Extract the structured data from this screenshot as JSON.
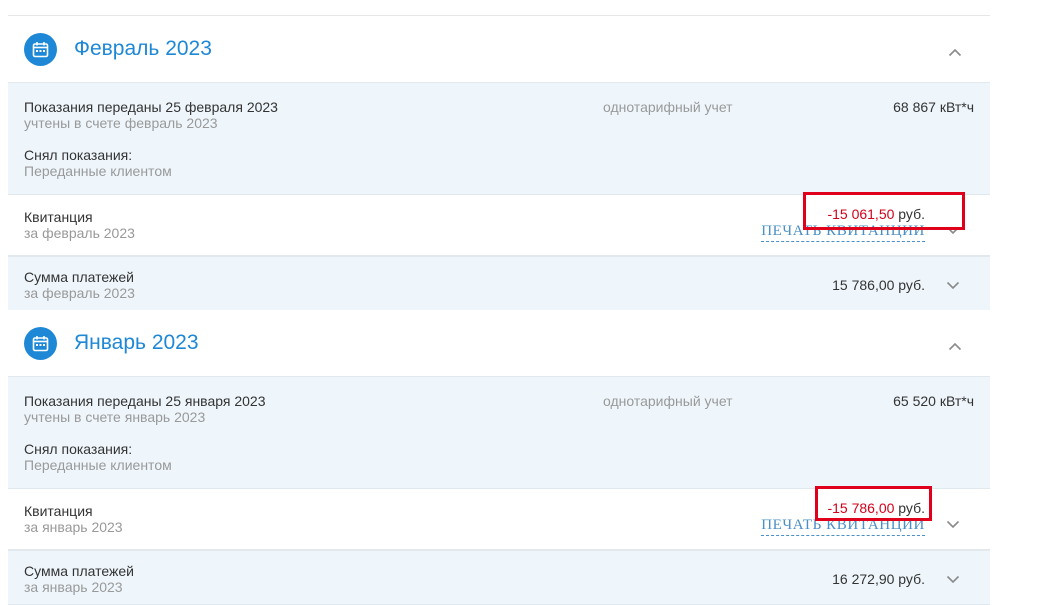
{
  "months": [
    {
      "title": "Февраль 2023",
      "readings": {
        "date_text": "Показания переданы 25 февраля 2023",
        "account_text": "учтены в счете февраль 2023",
        "tariff": "однотарифный учет",
        "value": "68 867 кВт*ч",
        "taken_by_label": "Снял показания:",
        "taken_by_value": "Переданные клиентом"
      },
      "receipt": {
        "label": "Квитанция",
        "period": "за февраль 2023",
        "amount": "-15 061,50",
        "currency": "руб.",
        "print_label": "ПЕЧАТЬ КВИТАНЦИИ"
      },
      "payments": {
        "label": "Сумма платежей",
        "period": "за февраль 2023",
        "amount": "15 786,00 руб."
      }
    },
    {
      "title": "Январь 2023",
      "readings": {
        "date_text": "Показания переданы 25 января 2023",
        "account_text": "учтены в счете январь 2023",
        "tariff": "однотарифный учет",
        "value": "65 520 кВт*ч",
        "taken_by_label": "Снял показания:",
        "taken_by_value": "Переданные клиентом"
      },
      "receipt": {
        "label": "Квитанция",
        "period": "за январь 2023",
        "amount": "-15 786,00",
        "currency": "руб.",
        "print_label": "ПЕЧАТЬ КВИТАНЦИИ"
      },
      "payments": {
        "label": "Сумма платежей",
        "period": "за январь 2023",
        "amount": "16 272,90 руб."
      }
    }
  ],
  "colors": {
    "accent": "#1e88d6",
    "negative": "#d0021b",
    "highlight": "#e0001b",
    "row_tint": "#eef6fc"
  },
  "icons": [
    "calendar-icon",
    "chevron-up-icon",
    "chevron-down-icon"
  ]
}
